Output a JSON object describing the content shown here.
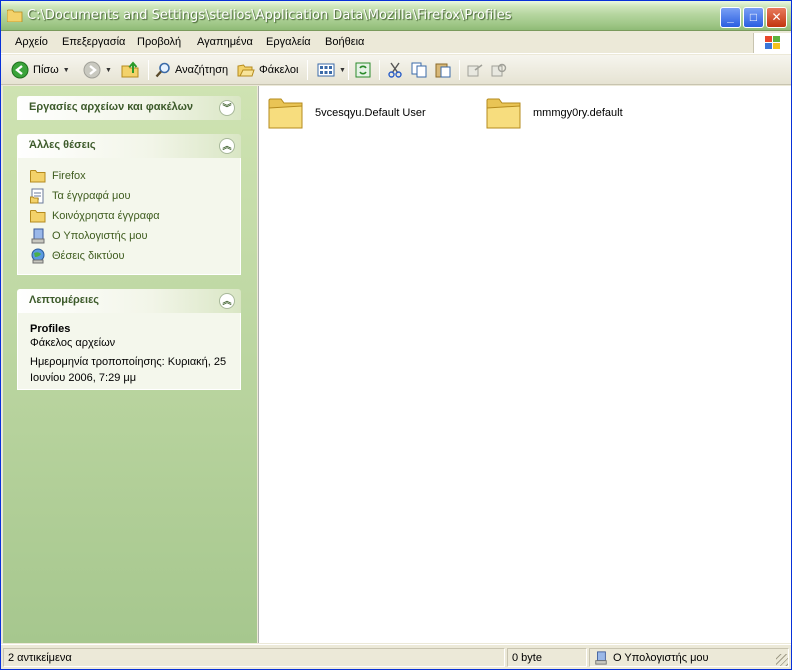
{
  "window": {
    "title": "C:\\Documents and Settings\\stelios\\Application Data\\Mozilla\\Firefox\\Profiles"
  },
  "menu": [
    "Αρχείο",
    "Επεξεργασία",
    "Προβολή",
    "Αγαπημένα",
    "Εργαλεία",
    "Βοήθεια"
  ],
  "toolbar": {
    "back_label": "Πίσω",
    "search_label": "Αναζήτηση",
    "folders_label": "Φάκελοι"
  },
  "taskpane": {
    "tasks_title": "Εργασίες αρχείων και φακέλων",
    "places_title": "Άλλες θέσεις",
    "places": [
      {
        "label": "Firefox",
        "icon": "folder-icon"
      },
      {
        "label": "Τα έγγραφά μου",
        "icon": "my-documents-icon"
      },
      {
        "label": "Κοινόχρηστα έγγραφα",
        "icon": "folder-icon"
      },
      {
        "label": "Ο Υπολογιστής μου",
        "icon": "my-computer-icon"
      },
      {
        "label": "Θέσεις δικτύου",
        "icon": "network-places-icon"
      }
    ],
    "details_title": "Λεπτομέρειες",
    "details": {
      "name": "Profiles",
      "type": "Φάκελος αρχείων",
      "modified_line1": "Ημερομηνία τροποποίησης: Κυριακή, 25",
      "modified_line2": "Ιουνίου 2006, 7:29 μμ"
    }
  },
  "files": [
    {
      "label": "5vcesqyu.Default User"
    },
    {
      "label": "mmmgy0ry.default"
    }
  ],
  "status": {
    "objects": "2 αντικείμενα",
    "size": "0 byte",
    "location": "Ο Υπολογιστής μου"
  },
  "colors": {
    "titlebar": "#b6d6a0",
    "taskpane": "#a6c78e",
    "link": "#3e5c1e"
  }
}
